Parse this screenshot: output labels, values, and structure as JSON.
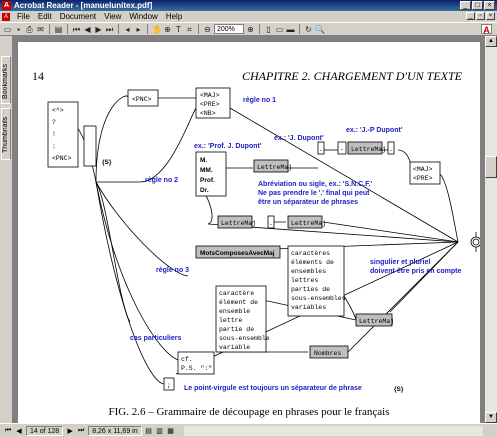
{
  "window": {
    "title": "Acrobat Reader - [manuelunitex.pdf]"
  },
  "menu": [
    "File",
    "Edit",
    "Document",
    "View",
    "Window",
    "Help"
  ],
  "toolbar": {
    "zoom": "200%"
  },
  "nav_tabs": [
    "Bookmarks",
    "Thumbnails"
  ],
  "page": {
    "number": "14",
    "chapter_heading": "CHAPITRE 2.  CHARGEMENT D'UN TEXTE",
    "caption": "FIG. 2.6 – Grammaire de découpage en phrases pour le français"
  },
  "diagram": {
    "init_box": [
      "<^>",
      "?",
      "!",
      ":",
      "<PNC>"
    ],
    "dieze": "{S}",
    "pnc": "<PNC>",
    "maj_box": [
      "<MAJ>",
      "<PRE>",
      "<NB>"
    ],
    "regle1": "règle no 1",
    "regle2": "règle no 2",
    "regle3": "règle no 3",
    "abbrev_box": [
      "M.",
      "MM.",
      "Prof.",
      "Dr."
    ],
    "ex1": "ex.: 'Prof. J. Dupont'",
    "ex2": "ex.: 'J. Dupont'",
    "ex3": "ex.: 'J.-P Dupont'",
    "lettremaj": "LettreMaj",
    "dot": ".",
    "dash": "-",
    "maj_pre": [
      "<MAJ>",
      "<PRE>"
    ],
    "abbrev_note": [
      "Abréviation ou sigle, ex.: 'S.N.C.F.'",
      "Ne pas prendre le '.' final qui peut",
      "être un séparateur de phrases"
    ],
    "motscomposes": "MotsComposesAvecMaj",
    "caracteres_box": [
      "caractères",
      "éléments de",
      "ensembles",
      "lettres",
      "parties de",
      "sous-ensembles",
      "variables"
    ],
    "caractere_box": [
      "caractère",
      "élément de",
      "ensemble",
      "lettre",
      "partie de",
      "sous-ensemble",
      "variable"
    ],
    "singulier_note": [
      "singulier et pluriel",
      "doivent être pris en compte"
    ],
    "cas_particuliers": "cas particuliers",
    "cf_box": [
      "cf.",
      "P.S. \":\""
    ],
    "nombres": "Nombres",
    "semicolon": ";",
    "pointvirgule": "Le point-virgule est toujours un séparateur de phrase",
    "dieze2": "{S}"
  },
  "status": {
    "page_field": "14 of 128",
    "size": "8,26 x 11,69 in"
  }
}
